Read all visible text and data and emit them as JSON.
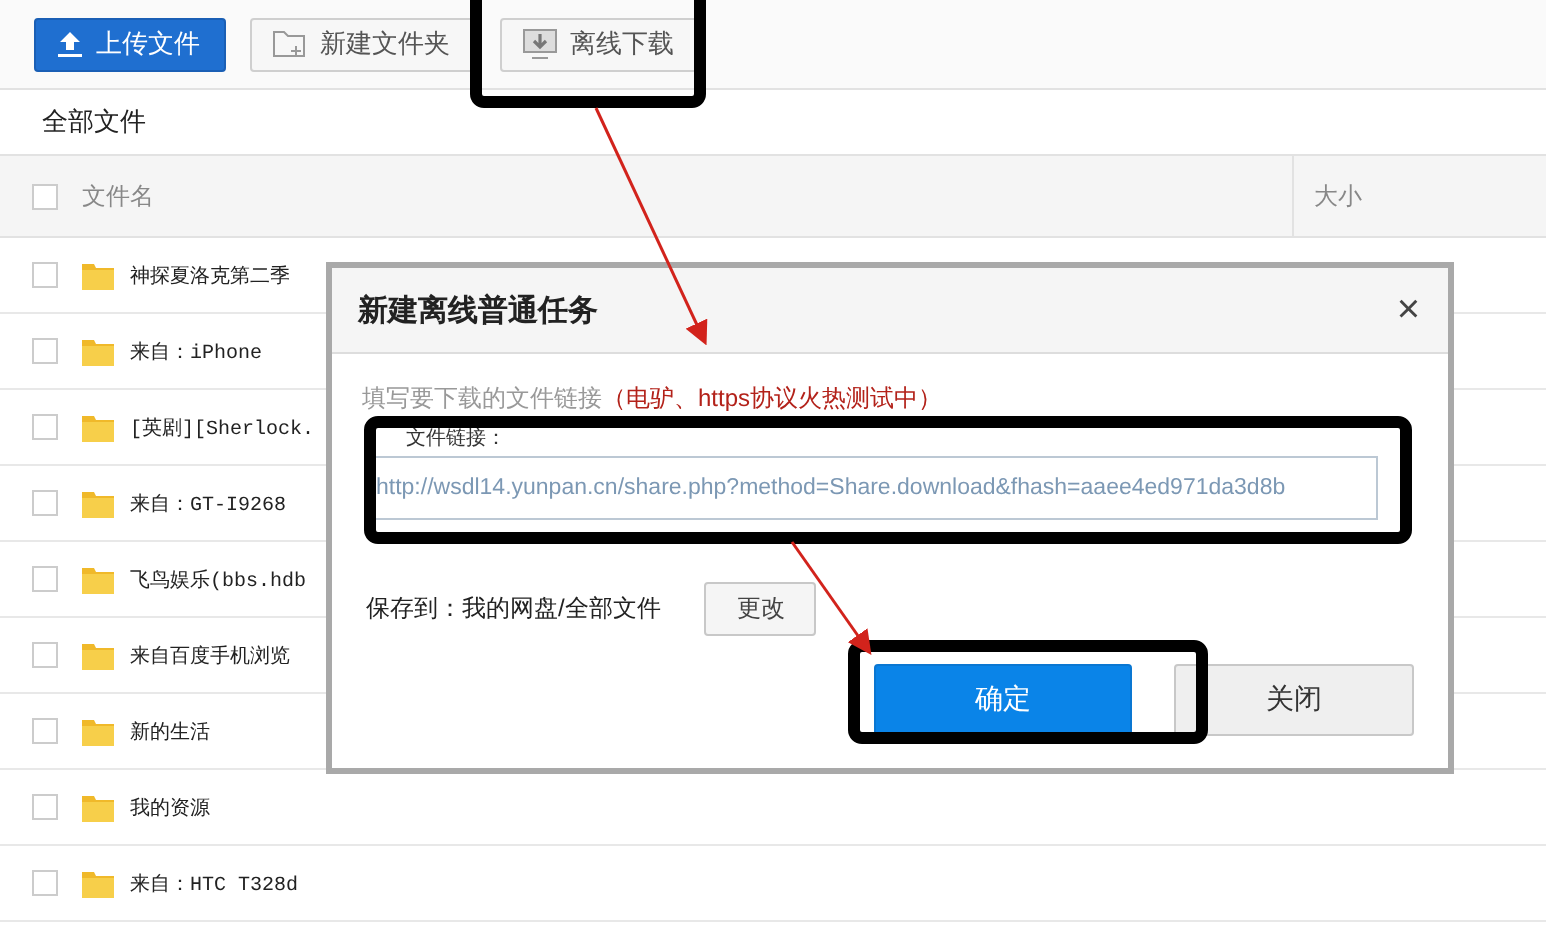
{
  "toolbar": {
    "buttons": [
      {
        "label": "上传文件",
        "kind": "upload"
      },
      {
        "label": "新建文件夹",
        "kind": "folder"
      },
      {
        "label": "离线下载",
        "kind": "download"
      }
    ]
  },
  "breadcrumb": "全部文件",
  "table": {
    "select_all": {
      "checked": false
    },
    "columns": [
      "文件名",
      "大小"
    ],
    "rows": [
      {
        "name": "神探夏洛克第二季",
        "checked": false
      },
      {
        "name": "来自：iPhone",
        "checked": false
      },
      {
        "name": "[英剧][Sherlock.",
        "checked": false
      },
      {
        "name": "来自：GT-I9268",
        "checked": false
      },
      {
        "name": "飞鸟娱乐(bbs.hdb",
        "checked": false
      },
      {
        "name": "来自百度手机浏览",
        "checked": false
      },
      {
        "name": "新的生活",
        "checked": false
      },
      {
        "name": "我的资源",
        "checked": false
      },
      {
        "name": "来自：HTC T328d",
        "checked": false
      }
    ]
  },
  "dialog": {
    "title": "新建离线普通任务",
    "close": "×",
    "hint": "填写要下载的文件链接",
    "hint_note": "（电驴、https协议火热测试中）",
    "field_label": "文件链接：",
    "url": "http://wsdl14.yunpan.cn/share.php?method=Share.download&fhash=aaee4ed971da3d8b",
    "save_to": "保存到：我的网盘/全部文件",
    "change_button": "更改",
    "confirm_button": "确定",
    "close_button": "关闭"
  }
}
